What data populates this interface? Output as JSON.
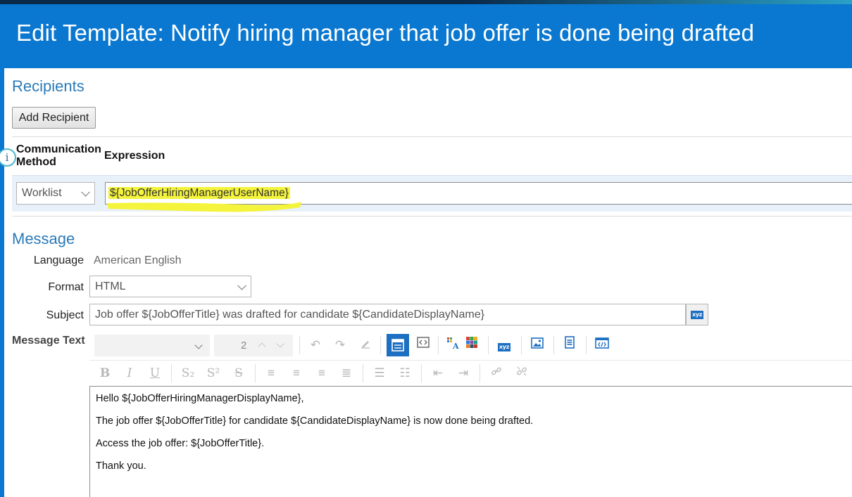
{
  "header": {
    "title": "Edit Template: Notify hiring manager that job offer is done being drafted"
  },
  "recipients": {
    "section_title": "Recipients",
    "add_button": "Add Recipient",
    "info_icon_glyph": "i",
    "columns": {
      "method": "Communication Method",
      "expression": "Expression"
    },
    "row": {
      "method": "Worklist",
      "expression": "${JobOfferHiringManagerUserName}"
    },
    "highlight_color": "#f4f43c"
  },
  "message": {
    "section_title": "Message",
    "language_label": "Language",
    "language_value": "American English",
    "format_label": "Format",
    "format_value": "HTML",
    "subject_label": "Subject",
    "subject_value": "Job offer ${JobOfferTitle} was drafted for candidate ${CandidateDisplayName}",
    "message_text_label": "Message Text",
    "subject_insert_icon": "xyz",
    "toolbar": {
      "font_size": "2",
      "icons_row1": [
        "undo-icon",
        "redo-icon",
        "eraser-icon",
        "rich-text-mode-icon",
        "source-mode-icon",
        "font-color-icon",
        "background-color-icon",
        "insert-token-icon",
        "insert-image-icon",
        "paragraph-icon",
        "code-icon"
      ],
      "icons_row2": [
        "bold-icon",
        "italic-icon",
        "underline-icon",
        "subscript-icon",
        "superscript-icon",
        "strikethrough-icon",
        "align-left-icon",
        "align-center-icon",
        "align-right-icon",
        "justify-icon",
        "bulleted-list-icon",
        "numbered-list-icon",
        "outdent-icon",
        "indent-icon",
        "link-icon",
        "unlink-icon"
      ],
      "bold": "B",
      "italic": "I",
      "underline": "U",
      "subscript": "S₂",
      "superscript": "S²",
      "strike": "S"
    },
    "body": [
      "Hello ${JobOfferHiringManagerDisplayName},",
      "The job offer ${JobOfferTitle} for candidate ${CandidateDisplayName} is now done being drafted.",
      "Access the job offer: ${JobOfferTitle}.",
      "Thank you."
    ]
  },
  "colors": {
    "header": "#0a78d1",
    "section_title": "#2a7ab8",
    "accent": "#1d6fc2"
  }
}
